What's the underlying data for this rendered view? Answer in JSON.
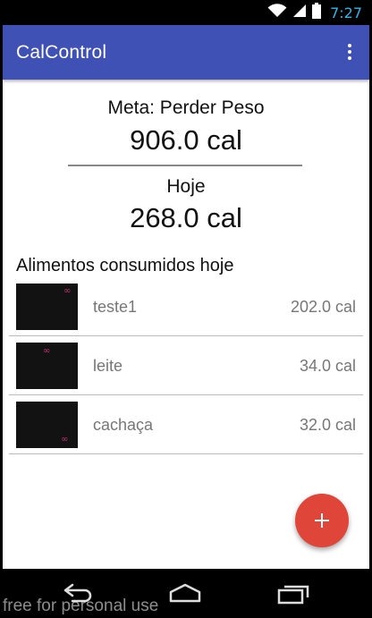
{
  "status_bar": {
    "time": "7:27",
    "wifi_icon": "wifi-icon",
    "signal_icon": "cell-signal-icon",
    "battery_icon": "battery-icon",
    "time_color": "#33b5e5"
  },
  "toolbar": {
    "title": "CalControl",
    "color": "#3f51b5",
    "overflow_icon": "more-vert-icon"
  },
  "summary": {
    "goal_label": "Meta: Perder Peso",
    "goal_value": "906.0 cal",
    "today_label": "Hoje",
    "today_value": "268.0 cal"
  },
  "foods": {
    "title": "Alimentos consumidos hoje",
    "items": [
      {
        "name": "teste1",
        "calories": "202.0 cal"
      },
      {
        "name": "leite",
        "calories": "34.0 cal"
      },
      {
        "name": "cachaça",
        "calories": "32.0 cal"
      }
    ]
  },
  "fab": {
    "icon": "plus-icon",
    "color": "#e0453a"
  },
  "nav": {
    "back_icon": "back-icon",
    "home_icon": "home-icon",
    "recents_icon": "recents-icon"
  },
  "watermark": "free for personal use"
}
